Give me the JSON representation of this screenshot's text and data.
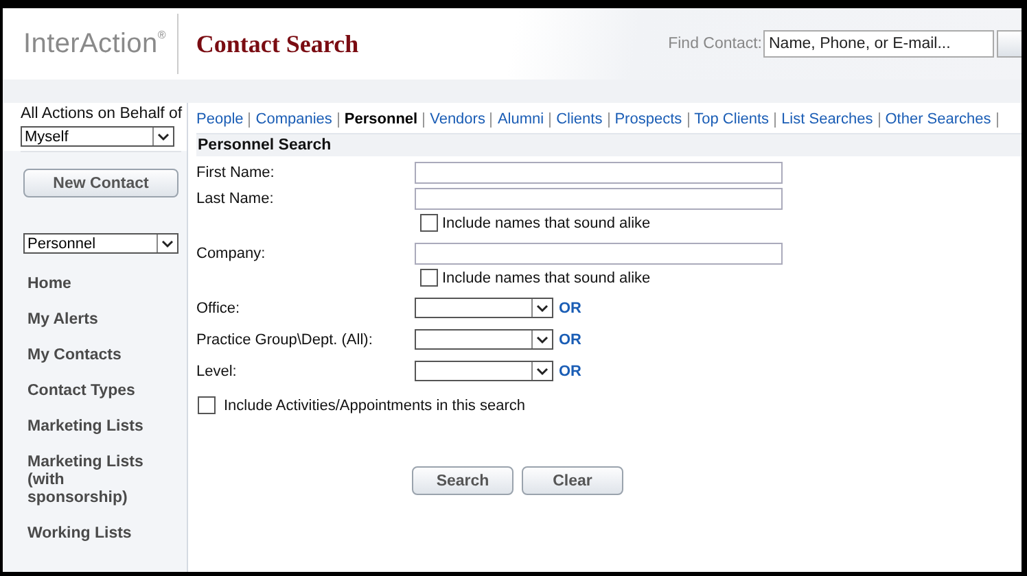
{
  "header": {
    "logo": "InterAction",
    "logo_mark": "®",
    "title": "Contact Search",
    "find_label": "Find Contact:",
    "find_placeholder": "Name, Phone, or E-mail..."
  },
  "sidebar": {
    "behalf_label": "All Actions on Behalf of",
    "behalf_value": "Myself",
    "new_button": "New Contact",
    "category_value": "Personnel",
    "items": [
      {
        "label": "Home"
      },
      {
        "label": "My Alerts"
      },
      {
        "label": "My Contacts"
      },
      {
        "label": "Contact Types"
      },
      {
        "label": "Marketing Lists"
      },
      {
        "label": "Marketing Lists (with sponsorship)"
      },
      {
        "label": "Working Lists"
      }
    ]
  },
  "tabs": [
    {
      "label": "People",
      "selected": false
    },
    {
      "label": "Companies",
      "selected": false
    },
    {
      "label": "Personnel",
      "selected": true
    },
    {
      "label": "Vendors",
      "selected": false
    },
    {
      "label": "Alumni",
      "selected": false
    },
    {
      "label": "Clients",
      "selected": false
    },
    {
      "label": "Prospects",
      "selected": false
    },
    {
      "label": "Top Clients",
      "selected": false
    },
    {
      "label": "List Searches",
      "selected": false
    },
    {
      "label": "Other Searches",
      "selected": false
    }
  ],
  "form": {
    "title": "Personnel Search",
    "rows": [
      {
        "kind": "text",
        "label": "First Name:"
      },
      {
        "kind": "text",
        "label": "Last Name:",
        "option": {
          "label": "Include names that sound alike",
          "checked": false
        }
      },
      {
        "kind": "text",
        "label": "Company:",
        "option": {
          "label": "Include names that sound alike",
          "checked": false
        }
      },
      {
        "kind": "select",
        "label": "Office:",
        "link": "OR"
      },
      {
        "kind": "select",
        "label": "Practice Group\\Dept. (All):",
        "link": "OR"
      },
      {
        "kind": "select",
        "label": "Level:",
        "link": "OR"
      }
    ],
    "include": {
      "label": "Include Activities/Appointments in this search",
      "checked": false
    },
    "buttons": [
      "Search",
      "Clear"
    ]
  }
}
